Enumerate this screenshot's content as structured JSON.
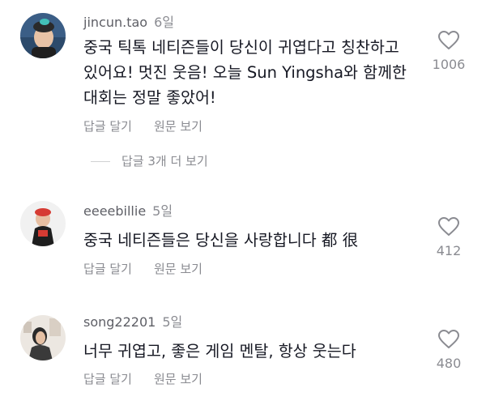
{
  "comments": [
    {
      "username": "jincun.tao",
      "time": "6일",
      "text": "중국 틱톡 네티즌들이 당신이 귀엽다고 칭찬하고 있어요! 멋진 웃음! 오늘 Sun Yingsha와 함께한 대회는 정말 좋았어!",
      "reply_label": "답글 달기",
      "view_label": "원문 보기",
      "likes": "1006",
      "avatar": "avatar-woman-teal-top"
    },
    {
      "username": "eeeebillie",
      "time": "5일",
      "text": "중국 네티즌들은 당신을 사랑합니다 都 很",
      "reply_label": "답글 달기",
      "view_label": "원문 보기",
      "likes": "412",
      "avatar": "avatar-figure-red-top"
    },
    {
      "username": "song22201",
      "time": "5일",
      "text": "너무 귀엽고, 좋은 게임 멘탈, 항상 웃는다",
      "reply_label": "답글 달기",
      "view_label": "원문 보기",
      "likes": "480",
      "avatar": "avatar-person-indoor"
    }
  ],
  "replies_toggle": "답글 3개 더 보기",
  "icons": {
    "like": "heart-outline-icon"
  },
  "colors": {
    "text": "#161823",
    "secondary": "#8a8b91",
    "background": "#ffffff"
  }
}
